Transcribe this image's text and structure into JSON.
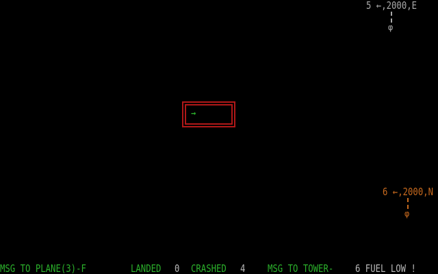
{
  "planes": [
    {
      "id_label": "5",
      "heading_glyph": "←",
      "altitude": "2000",
      "direction": "E",
      "plane_icon": "plane-marker",
      "color": "#a8a8a8"
    },
    {
      "id_label": "6",
      "heading_glyph": "←",
      "altitude": "2000",
      "direction": "N",
      "plane_icon": "plane-marker",
      "color": "#c86a1e"
    }
  ],
  "plane_5_text": "5 ←,2000,E",
  "plane_6_text": "6 ←,2000,N",
  "plane_glyph": "φ",
  "runway": {
    "arrow_glyph": "→",
    "color": "#b01818"
  },
  "status": {
    "msg_to_plane": "MSG TO PLANE(3)-F",
    "landed_label": "LANDED",
    "landed_count": "0",
    "crashed_label": "CRASHED",
    "crashed_count": "4",
    "msg_to_tower": "MSG TO TOWER-",
    "tower_message": "6 FUEL LOW !"
  },
  "colors": {
    "background": "#000000",
    "status_green": "#2bb02b",
    "value_grey": "#b8b8b8"
  }
}
